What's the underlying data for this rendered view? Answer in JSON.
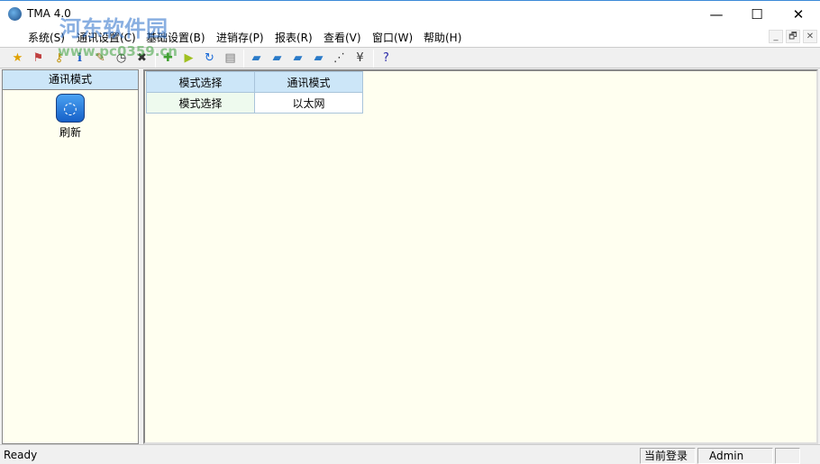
{
  "window": {
    "title": "TMA 4.0",
    "minimize": "—",
    "maximize": "☐",
    "close": "✕"
  },
  "watermark": {
    "line1": "河东软件园",
    "line2": "www.pc0359.cn"
  },
  "menu": [
    "系统(S)",
    "通讯设置(C)",
    "基础设置(B)",
    "进销存(P)",
    "报表(R)",
    "查看(V)",
    "窗口(W)",
    "帮助(H)"
  ],
  "mdi_controls": {
    "minimize": "_",
    "restore": "🗗",
    "close": "✕"
  },
  "toolbar": [
    {
      "icon": "star-icon",
      "glyph": "★",
      "color": "#e0a000"
    },
    {
      "icon": "flag-icon",
      "glyph": "⚑",
      "color": "#c04040"
    },
    {
      "icon": "key-icon",
      "glyph": "⚷",
      "color": "#c09000"
    },
    {
      "icon": "info-icon",
      "glyph": "ℹ",
      "color": "#1a5cc8"
    },
    {
      "icon": "note-icon",
      "glyph": "✎",
      "color": "#a07020"
    },
    {
      "icon": "clock-icon",
      "glyph": "◷",
      "color": "#333"
    },
    {
      "icon": "tools-icon",
      "glyph": "✖",
      "color": "#333"
    },
    {
      "icon": "add-icon",
      "glyph": "✚",
      "color": "#40a030"
    },
    {
      "icon": "play-icon",
      "glyph": "▶",
      "color": "#a0c020"
    },
    {
      "icon": "refresh-icon",
      "glyph": "↻",
      "color": "#1a6ad8"
    },
    {
      "icon": "database-icon",
      "glyph": "▤",
      "color": "#777"
    },
    {
      "icon": "folder-icon",
      "glyph": "▰",
      "color": "#2a7ac8"
    },
    {
      "icon": "folder-lock-icon",
      "glyph": "▰",
      "color": "#2a7ac8"
    },
    {
      "icon": "folder-table-icon",
      "glyph": "▰",
      "color": "#2a7ac8"
    },
    {
      "icon": "folder-key-icon",
      "glyph": "▰",
      "color": "#2a7ac8"
    },
    {
      "icon": "chart-icon",
      "glyph": "⋰",
      "color": "#333"
    },
    {
      "icon": "yen-icon",
      "glyph": "¥",
      "color": "#333"
    },
    {
      "icon": "help-icon",
      "glyph": "?",
      "color": "#2a2aa8"
    }
  ],
  "left_panel": {
    "header": "通讯模式",
    "refresh_label": "刷新"
  },
  "table": {
    "headers": [
      "模式选择",
      "通讯模式"
    ],
    "rows": [
      [
        "模式选择",
        "以太网"
      ]
    ]
  },
  "status": {
    "text": "Ready",
    "login_label": "当前登录",
    "user": "Admin"
  }
}
